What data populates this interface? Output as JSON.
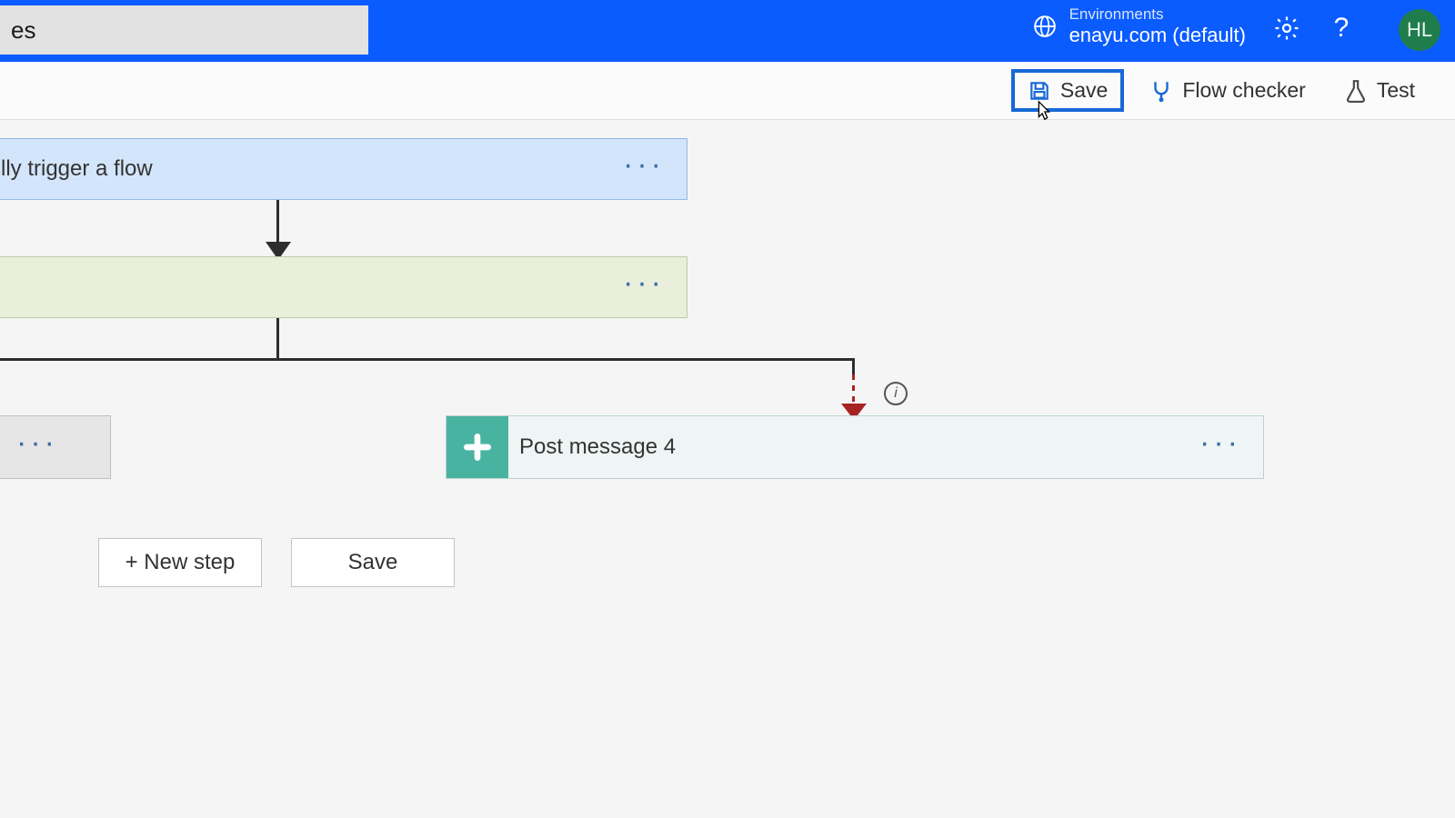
{
  "header": {
    "title_suffix": "es",
    "env_label": "Environments",
    "env_name": "enayu.com (default)",
    "avatar_initials": "HL"
  },
  "toolbar": {
    "save": "Save",
    "flow_checker": "Flow checker",
    "test": "Test"
  },
  "canvas": {
    "trigger_label": "lly trigger a flow",
    "post_msg_label": "Post message 4"
  },
  "bottom": {
    "new_step": "+ New step",
    "save": "Save"
  }
}
